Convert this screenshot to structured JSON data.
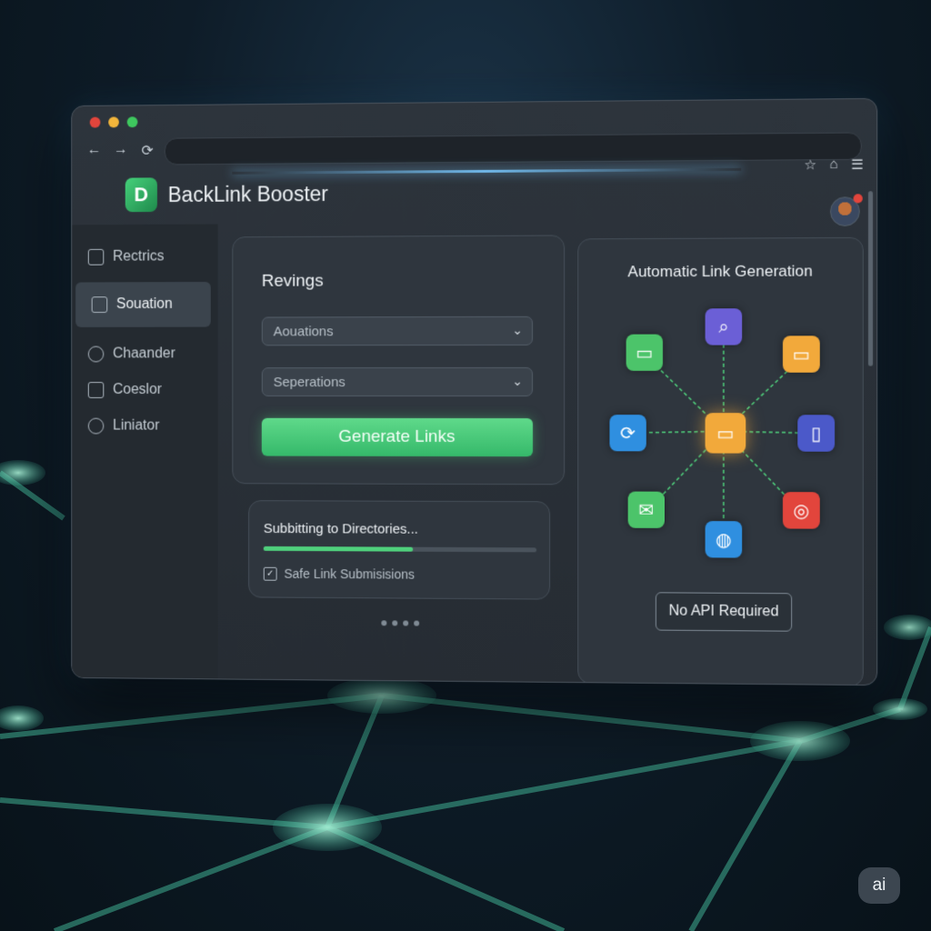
{
  "app": {
    "name": "BackLink Booster"
  },
  "toolbar": {
    "back": "←",
    "forward": "→",
    "refresh": "⟳",
    "star": "☆",
    "home": "⌂",
    "menu": "☰"
  },
  "sidebar": {
    "items": [
      {
        "label": "Rectrics",
        "icon": "chart-icon"
      },
      {
        "label": "Souation",
        "icon": "grid-icon"
      },
      {
        "label": "Chaander",
        "icon": "chain-icon"
      },
      {
        "label": "Coeslor",
        "icon": "calendar-icon"
      },
      {
        "label": "Liniator",
        "icon": "settings-icon"
      }
    ]
  },
  "form": {
    "title": "Revings",
    "select1": "Aouations",
    "select2": "Seperations",
    "generate_label": "Generate Links"
  },
  "status": {
    "text": "Subbitting to Directories...",
    "progress": 0.55,
    "checkbox_label": "Safe Link Submisisions"
  },
  "link_panel": {
    "title": "Automatic Link Generation",
    "api_label": "No API Required"
  },
  "colors": {
    "accent": "#4fd07c",
    "node_green": "#4cc46a",
    "node_purple": "#6b5fd6",
    "node_orange": "#f2a93b",
    "node_blue": "#2f8fe0",
    "node_red": "#e2453c"
  },
  "badge": {
    "text": "ai"
  }
}
